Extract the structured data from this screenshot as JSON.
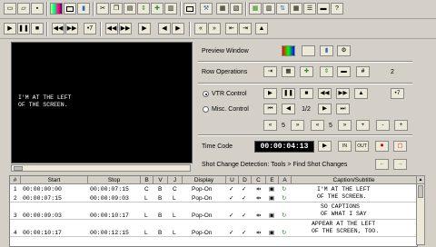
{
  "toolbar1": {
    "icons": [
      "new-icon",
      "open-icon",
      "save-icon",
      "color-bars-icon",
      "blank-icon",
      "book-icon",
      "cut-icon",
      "copy-icon",
      "paste-icon",
      "split-icon",
      "merge-icon",
      "insert-icon",
      "frame-icon",
      "wand-icon",
      "list-icon",
      "list-alt-icon",
      "align-icon",
      "align-alt-icon",
      "grid-icon",
      "up-down-icon",
      "stack-icon",
      "ruler-icon",
      "help-icon"
    ]
  },
  "toolbar2": {
    "buttons": [
      "▶",
      "❚❚",
      "■",
      "◀◀",
      "▶▶",
      "•7",
      "◀◀",
      "▶▶",
      "▶",
      "◀",
      "▶",
      "«",
      "»",
      "⇤",
      "⇥",
      "▲"
    ]
  },
  "video": {
    "caption_line1": "I'M AT THE LEFT",
    "caption_line2": "OF THE SCREEN."
  },
  "panel": {
    "preview_window_label": "Preview Window",
    "row_operations_label": "Row Operations",
    "row_ops_count_symbol": "#",
    "row_ops_count": "2",
    "vtr_control_label": "VTR Control",
    "misc_control_label": "Misc. Control",
    "speed_value": "1/2",
    "step_value_a": "5",
    "step_value_b": "5",
    "time_code_label": "Time Code",
    "time_code_value": "00:00:04:13",
    "in_label": "IN",
    "out_label": "OUT",
    "shot_change_text": "Shot Change Detection: Tools > Find Shot Changes"
  },
  "table": {
    "headers": [
      "#",
      "Start",
      "Stop",
      "B",
      "V",
      "J",
      "Display",
      "U",
      "D",
      "C",
      "E",
      "A",
      "Caption/Subtitle"
    ],
    "rows": [
      {
        "num": "1",
        "start": "00:00:00:00",
        "stop": "00:00:07:15",
        "b": "C",
        "v": "B",
        "j": "C",
        "display": "Pop-On",
        "caption": "I'M AT THE LEFT\nOF THE SCREEN."
      },
      {
        "num": "2",
        "start": "00:00:07:15",
        "stop": "00:00:09:03",
        "b": "L",
        "v": "B",
        "j": "L",
        "display": "Pop-On",
        "caption": "SO CAPTIONS\nOF WHAT I SAY"
      },
      {
        "num": "3",
        "start": "00:00:09:03",
        "stop": "00:00:10:17",
        "b": "L",
        "v": "B",
        "j": "L",
        "display": "Pop-On",
        "caption": "APPEAR AT THE LEFT\nOF THE SCREEN, TOO."
      },
      {
        "num": "4",
        "start": "00:00:10:17",
        "stop": "00:00:12:15",
        "b": "L",
        "v": "B",
        "j": "L",
        "display": "Pop-On",
        "caption": ""
      }
    ]
  },
  "colors": {
    "chrome": "#d4d0c8",
    "video_bg": "#000000",
    "timecode_bg": "#000000",
    "record_red": "#cc0000",
    "accent_green": "#2e8b2e"
  }
}
